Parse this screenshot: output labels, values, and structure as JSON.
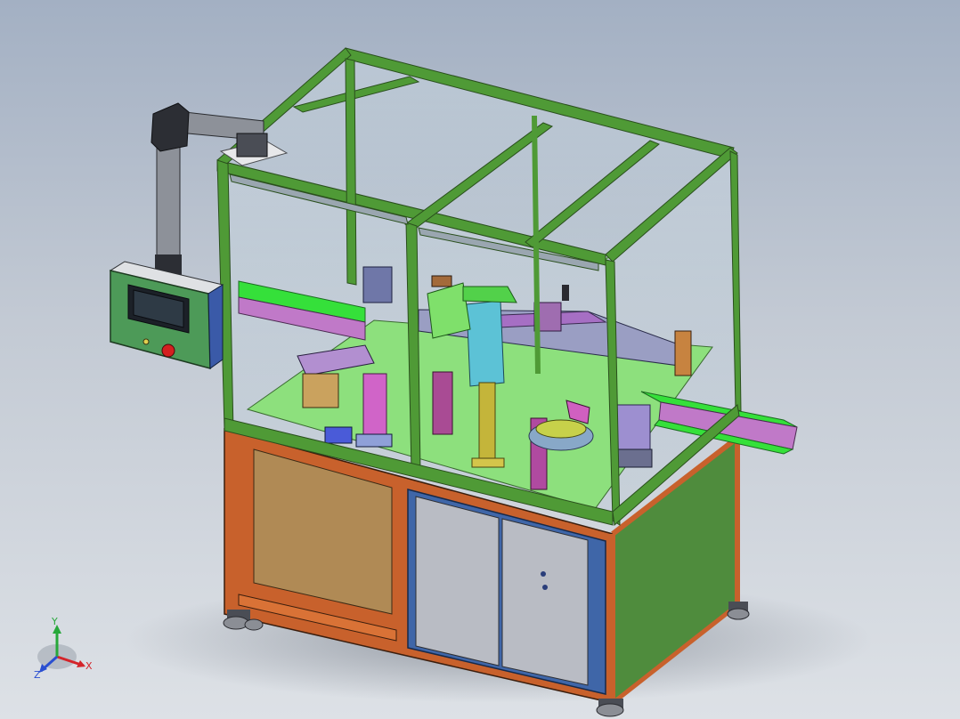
{
  "viewport": {
    "background": "#c3cad4"
  },
  "triad": {
    "x_label": "X",
    "y_label": "Y",
    "z_label": "Z",
    "x_color": "#d4242a",
    "y_color": "#27a83a",
    "z_color": "#2a4fd1"
  },
  "machine": {
    "frame_color": "#4f9a36",
    "conveyor_belt_color": "#35e03a",
    "conveyor_rail_color": "#c079c8",
    "table_top_color": "#8de07d",
    "base_frame_color": "#c8612c",
    "base_side_panel_color": "#4f8c3d",
    "base_left_panel_color": "#b08a55",
    "base_door_color": "#b9bcc4",
    "emergency_stop_color": "#d42020",
    "hmi_screen_color": "#2e3a45"
  }
}
